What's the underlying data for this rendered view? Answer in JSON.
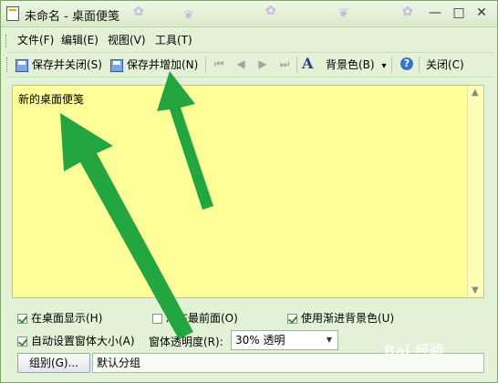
{
  "window": {
    "title": "未命名 - 桌面便笺",
    "minimize": "—",
    "maximize": "□",
    "close": "✕"
  },
  "menu": [
    {
      "label": "文件(F)"
    },
    {
      "label": "编辑(E)"
    },
    {
      "label": "视图(V)"
    },
    {
      "label": "工具(T)"
    }
  ],
  "toolbar": {
    "save_close": "保存并关闭(S)",
    "save_add": "保存并增加(N)",
    "bg_color": "背景色(B)",
    "close": "关闭(C)",
    "nav_first": "⏮",
    "nav_prev": "◀",
    "nav_next": "▶",
    "nav_last": "⏭",
    "font_glyph": "A",
    "dropdown_glyph": "▾",
    "help_glyph": "?"
  },
  "editor": {
    "text": "新的桌面便笺"
  },
  "options": {
    "show_on_desktop": {
      "label": "在桌面显示(H)",
      "checked": true
    },
    "always_on_top": {
      "label": "总在最前面(O)",
      "checked": false
    },
    "gradient_bg": {
      "label": "使用渐进背景色(U)",
      "checked": true
    },
    "auto_size": {
      "label": "自动设置窗体大小(A)",
      "checked": true
    },
    "transparency_label": "窗体透明度(R):",
    "transparency_value": "30% 透明"
  },
  "group": {
    "button_label": "组别(G)...",
    "value": "默认分组"
  },
  "watermark": "Bai 经验",
  "colors": {
    "note_background": "#ffff99",
    "window_background": "#e3f1d6",
    "annotation_arrow": "#23a640"
  }
}
